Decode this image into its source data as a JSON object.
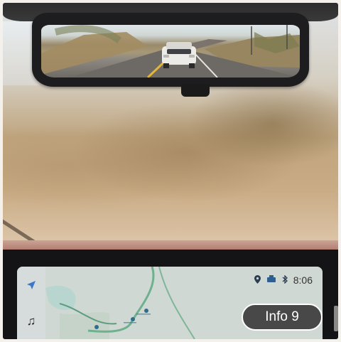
{
  "infotainment": {
    "clock": "8:06",
    "nav_icon": "navigation-arrow-icon",
    "music_icon": "music-note-icon",
    "status_icons": [
      "location-pin-icon",
      "signal-icon",
      "bluetooth-icon"
    ]
  },
  "info_button": {
    "label": "Info 9"
  },
  "colors": {
    "nav_accent": "#3b78c7",
    "map_water": "#b8d6cf",
    "map_road": "#6fb08f"
  }
}
